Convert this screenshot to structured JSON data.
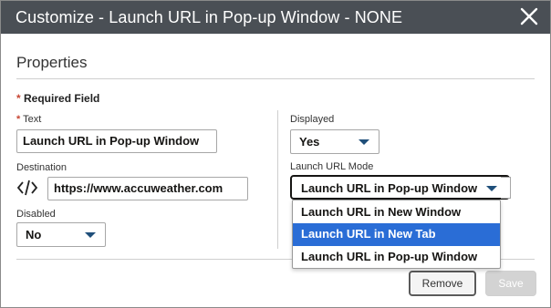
{
  "dialog": {
    "title": "Customize - Launch URL in Pop-up Window - NONE",
    "close_icon": "close-icon"
  },
  "properties": {
    "section_title": "Properties",
    "required_star": "*",
    "required_note": "Required Field",
    "text_label": "Text",
    "text_value": "Launch URL in Pop-up Window",
    "destination_label": "Destination",
    "destination_icon": "code-icon",
    "destination_value": "https://www.accuweather.com",
    "disabled_label": "Disabled",
    "disabled_value": "No",
    "displayed_label": "Displayed",
    "displayed_value": "Yes",
    "launch_mode_label": "Launch URL Mode",
    "launch_mode_value": "Launch URL in Pop-up Window"
  },
  "dropdown": {
    "options": [
      {
        "label": "Launch URL in New Window",
        "selected": false
      },
      {
        "label": "Launch URL in New Tab",
        "selected": true
      },
      {
        "label": "Launch URL in Pop-up Window",
        "selected": false
      }
    ]
  },
  "footer": {
    "remove_label": "Remove",
    "save_label": "Save"
  },
  "colors": {
    "titlebar": "#4a4f55",
    "required": "#c74634",
    "highlight": "#2a6dd6"
  }
}
